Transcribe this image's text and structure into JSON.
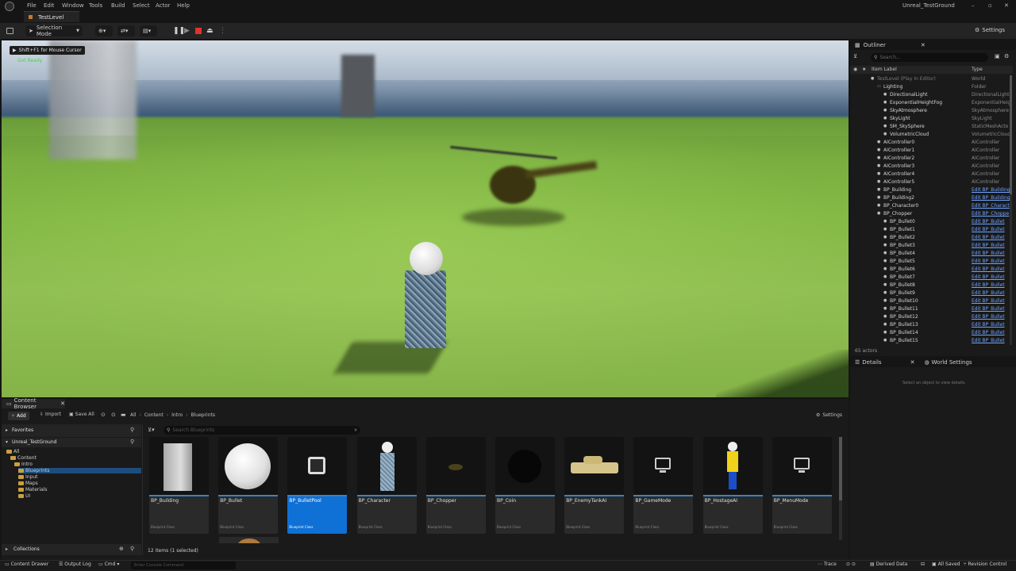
{
  "menu": {
    "items": [
      "File",
      "Edit",
      "Window",
      "Tools",
      "Build",
      "Select",
      "Actor",
      "Help"
    ],
    "project_name": "Unreal_TestGround"
  },
  "tabs": {
    "level": "TestLevel"
  },
  "toolbar": {
    "mode": "Selection Mode",
    "settings": "Settings"
  },
  "viewport": {
    "hint": "Shift+F1 for Mouse Cursor",
    "status": "Got Ready"
  },
  "outliner": {
    "title": "Outliner",
    "search_placeholder": "Search...",
    "col_label": "Item Label",
    "col_type": "Type",
    "rows": [
      {
        "label": "TestLevel (Play In Editor)",
        "type": "World",
        "indent": 0,
        "link": false,
        "dim": true
      },
      {
        "label": "Lighting",
        "type": "Folder",
        "indent": 1,
        "link": false,
        "dim": false
      },
      {
        "label": "DirectionalLight",
        "type": "DirectionalLight",
        "indent": 2,
        "link": false,
        "dim": false
      },
      {
        "label": "ExponentialHeightFog",
        "type": "ExponentialHeig",
        "indent": 2,
        "link": false,
        "dim": false
      },
      {
        "label": "SkyAtmosphere",
        "type": "SkyAtmosphere",
        "indent": 2,
        "link": false,
        "dim": false
      },
      {
        "label": "SkyLight",
        "type": "SkyLight",
        "indent": 2,
        "link": false,
        "dim": false
      },
      {
        "label": "SM_SkySphere",
        "type": "StaticMeshActo",
        "indent": 2,
        "link": false,
        "dim": false
      },
      {
        "label": "VolumetricCloud",
        "type": "VolumetricCloud",
        "indent": 2,
        "link": false,
        "dim": false
      },
      {
        "label": "AIController0",
        "type": "AIController",
        "indent": 1,
        "link": false,
        "dim": false
      },
      {
        "label": "AIController1",
        "type": "AIController",
        "indent": 1,
        "link": false,
        "dim": false
      },
      {
        "label": "AIController2",
        "type": "AIController",
        "indent": 1,
        "link": false,
        "dim": false
      },
      {
        "label": "AIController3",
        "type": "AIController",
        "indent": 1,
        "link": false,
        "dim": false
      },
      {
        "label": "AIController4",
        "type": "AIController",
        "indent": 1,
        "link": false,
        "dim": false
      },
      {
        "label": "AIController5",
        "type": "AIController",
        "indent": 1,
        "link": false,
        "dim": false
      },
      {
        "label": "BP_Building",
        "type": "Edit BP_Building",
        "indent": 1,
        "link": true,
        "dim": false
      },
      {
        "label": "BP_Building2",
        "type": "Edit BP_Building",
        "indent": 1,
        "link": true,
        "dim": false
      },
      {
        "label": "BP_Character0",
        "type": "Edit BP_Charact",
        "indent": 1,
        "link": true,
        "dim": false
      },
      {
        "label": "BP_Chopper",
        "type": "Edit BP_Choppe",
        "indent": 1,
        "link": true,
        "dim": false
      },
      {
        "label": "BP_Bullet0",
        "type": "Edit BP_Bullet",
        "indent": 2,
        "link": true,
        "dim": false
      },
      {
        "label": "BP_Bullet1",
        "type": "Edit BP_Bullet",
        "indent": 2,
        "link": true,
        "dim": false
      },
      {
        "label": "BP_Bullet2",
        "type": "Edit BP_Bullet",
        "indent": 2,
        "link": true,
        "dim": false
      },
      {
        "label": "BP_Bullet3",
        "type": "Edit BP_Bullet",
        "indent": 2,
        "link": true,
        "dim": false
      },
      {
        "label": "BP_Bullet4",
        "type": "Edit BP_Bullet",
        "indent": 2,
        "link": true,
        "dim": false
      },
      {
        "label": "BP_Bullet5",
        "type": "Edit BP_Bullet",
        "indent": 2,
        "link": true,
        "dim": false
      },
      {
        "label": "BP_Bullet6",
        "type": "Edit BP_Bullet",
        "indent": 2,
        "link": true,
        "dim": false
      },
      {
        "label": "BP_Bullet7",
        "type": "Edit BP_Bullet",
        "indent": 2,
        "link": true,
        "dim": false
      },
      {
        "label": "BP_Bullet8",
        "type": "Edit BP_Bullet",
        "indent": 2,
        "link": true,
        "dim": false
      },
      {
        "label": "BP_Bullet9",
        "type": "Edit BP_Bullet",
        "indent": 2,
        "link": true,
        "dim": false
      },
      {
        "label": "BP_Bullet10",
        "type": "Edit BP_Bullet",
        "indent": 2,
        "link": true,
        "dim": false
      },
      {
        "label": "BP_Bullet11",
        "type": "Edit BP_Bullet",
        "indent": 2,
        "link": true,
        "dim": false
      },
      {
        "label": "BP_Bullet12",
        "type": "Edit BP_Bullet",
        "indent": 2,
        "link": true,
        "dim": false
      },
      {
        "label": "BP_Bullet13",
        "type": "Edit BP_Bullet",
        "indent": 2,
        "link": true,
        "dim": false
      },
      {
        "label": "BP_Bullet14",
        "type": "Edit BP_Bullet",
        "indent": 2,
        "link": true,
        "dim": false
      },
      {
        "label": "BP_Bullet15",
        "type": "Edit BP_Bullet",
        "indent": 2,
        "link": true,
        "dim": false
      }
    ],
    "actor_count": "65 actors"
  },
  "details": {
    "title": "Details",
    "world_settings": "World Settings",
    "empty_text": "Select an object to view details."
  },
  "content_browser": {
    "title": "Content Browser",
    "add": "Add",
    "import": "Import",
    "save_all": "Save All",
    "breadcrumb": [
      "All",
      "Content",
      "Intro",
      "Blueprints"
    ],
    "settings": "Settings",
    "favorites": "Favorites",
    "project": "Unreal_TestGround",
    "search_placeholder": "Search Blueprints",
    "folders": [
      {
        "name": "All",
        "indent": 0,
        "selected": false
      },
      {
        "name": "Content",
        "indent": 1,
        "selected": false
      },
      {
        "name": "Intro",
        "indent": 2,
        "selected": false
      },
      {
        "name": "Blueprints",
        "indent": 3,
        "selected": true
      },
      {
        "name": "Input",
        "indent": 3,
        "selected": false
      },
      {
        "name": "Maps",
        "indent": 3,
        "selected": false
      },
      {
        "name": "Materials",
        "indent": 3,
        "selected": false
      },
      {
        "name": "UI",
        "indent": 3,
        "selected": false
      }
    ],
    "assets": [
      {
        "name": "BP_Building",
        "class": "Blueprint Class",
        "thumb": "building"
      },
      {
        "name": "BP_Bullet",
        "class": "Blueprint Class",
        "thumb": "sphere"
      },
      {
        "name": "BP_BulletPool",
        "class": "Blueprint Class",
        "thumb": "blueprint-icon"
      },
      {
        "name": "BP_Character",
        "class": "Blueprint Class",
        "thumb": "character"
      },
      {
        "name": "BP_Chopper",
        "class": "Blueprint Class",
        "thumb": "chopper"
      },
      {
        "name": "BP_Coin",
        "class": "Blueprint Class",
        "thumb": "dark"
      },
      {
        "name": "BP_EnemyTankAI",
        "class": "Blueprint Class",
        "thumb": "tank"
      },
      {
        "name": "BP_GameMode",
        "class": "Blueprint Class",
        "thumb": "gamemode"
      },
      {
        "name": "BP_HostageAI",
        "class": "Blueprint Class",
        "thumb": "hostage"
      },
      {
        "name": "BP_MenuMode",
        "class": "Blueprint Class",
        "thumb": "gamemode"
      }
    ],
    "selected_asset": "BP_BulletPool",
    "collections": "Collections",
    "item_count": "12 items (1 selected)"
  },
  "statusbar": {
    "content_drawer": "Content Drawer",
    "output_log": "Output Log",
    "cmd": "Cmd",
    "console_placeholder": "Enter Console Command",
    "trace": "Trace",
    "derived_data": "Derived Data",
    "all_saved": "All Saved",
    "revision_control": "Revision Control"
  }
}
